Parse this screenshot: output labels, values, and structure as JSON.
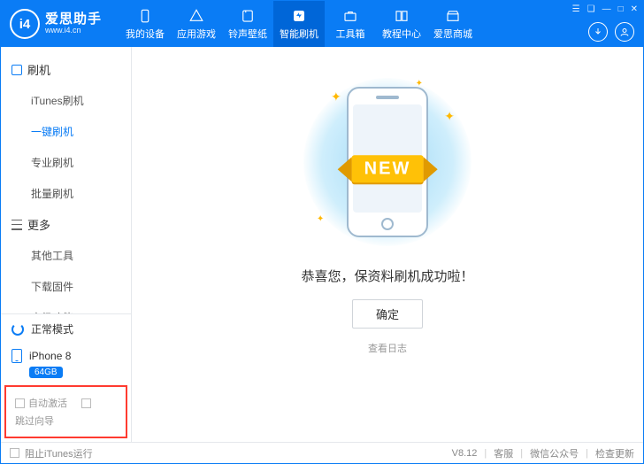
{
  "brand": {
    "name": "爱思助手",
    "url": "www.i4.cn",
    "logo_text": "i4"
  },
  "tabs": [
    {
      "label": "我的设备"
    },
    {
      "label": "应用游戏"
    },
    {
      "label": "铃声壁纸"
    },
    {
      "label": "智能刷机",
      "active": true
    },
    {
      "label": "工具箱"
    },
    {
      "label": "教程中心"
    },
    {
      "label": "爱思商城"
    }
  ],
  "sidebar": {
    "group1": {
      "title": "刷机",
      "items": [
        "iTunes刷机",
        "一键刷机",
        "专业刷机",
        "批量刷机"
      ],
      "active_index": 1
    },
    "group2": {
      "title": "更多",
      "items": [
        "其他工具",
        "下载固件",
        "高级功能"
      ]
    },
    "mode": "正常模式",
    "device": {
      "name": "iPhone 8",
      "capacity": "64GB"
    },
    "checks": {
      "auto_activate": "自动激活",
      "skip_guide": "跳过向导"
    }
  },
  "main": {
    "ribbon": "NEW",
    "success": "恭喜您，保资料刷机成功啦！",
    "ok": "确定",
    "view_log": "查看日志"
  },
  "status": {
    "block_itunes": "阻止iTunes运行",
    "version": "V8.12",
    "support": "客服",
    "wechat": "微信公众号",
    "check_update": "检查更新"
  }
}
